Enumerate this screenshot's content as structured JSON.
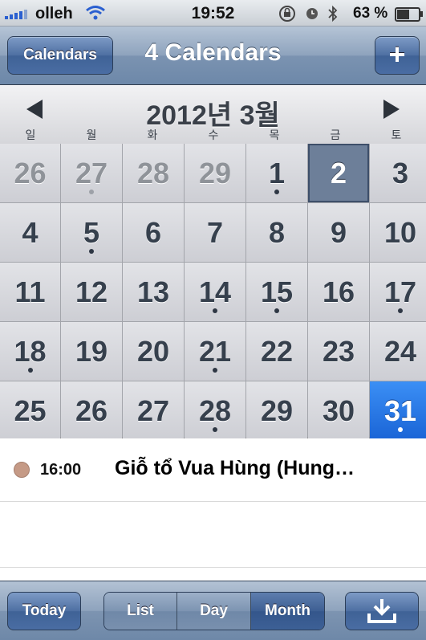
{
  "status_bar": {
    "carrier": "olleh",
    "time": "19:52",
    "battery_percent": "63 %",
    "battery_level": 0.63,
    "icons": [
      "signal-icon",
      "wifi-icon",
      "rotation-lock-icon",
      "alarm-icon",
      "bluetooth-icon",
      "battery-icon"
    ]
  },
  "nav": {
    "calendars_button": "Calendars",
    "title": "4 Calendars",
    "add_button": "+"
  },
  "month": {
    "title": "2012년 3월",
    "weekdays": [
      "일",
      "월",
      "화",
      "수",
      "목",
      "금",
      "토"
    ]
  },
  "days": [
    {
      "label": "26",
      "other_month": true,
      "event": false
    },
    {
      "label": "27",
      "other_month": true,
      "event": true
    },
    {
      "label": "28",
      "other_month": true,
      "event": false
    },
    {
      "label": "29",
      "other_month": true,
      "event": false
    },
    {
      "label": "1",
      "event": true
    },
    {
      "label": "2",
      "event": false,
      "selected": true
    },
    {
      "label": "3",
      "event": false
    },
    {
      "label": "4",
      "event": false
    },
    {
      "label": "5",
      "event": true
    },
    {
      "label": "6",
      "event": false
    },
    {
      "label": "7",
      "event": false
    },
    {
      "label": "8",
      "event": false
    },
    {
      "label": "9",
      "event": false
    },
    {
      "label": "10",
      "event": false
    },
    {
      "label": "11",
      "event": false
    },
    {
      "label": "12",
      "event": false
    },
    {
      "label": "13",
      "event": false
    },
    {
      "label": "14",
      "event": true
    },
    {
      "label": "15",
      "event": true
    },
    {
      "label": "16",
      "event": false
    },
    {
      "label": "17",
      "event": true
    },
    {
      "label": "18",
      "event": true
    },
    {
      "label": "19",
      "event": false
    },
    {
      "label": "20",
      "event": false
    },
    {
      "label": "21",
      "event": true
    },
    {
      "label": "22",
      "event": false
    },
    {
      "label": "23",
      "event": false
    },
    {
      "label": "24",
      "event": false
    },
    {
      "label": "25",
      "event": false
    },
    {
      "label": "26",
      "event": false
    },
    {
      "label": "27",
      "event": false
    },
    {
      "label": "28",
      "event": true
    },
    {
      "label": "29",
      "event": false
    },
    {
      "label": "30",
      "event": false
    },
    {
      "label": "31",
      "event": true,
      "today": true
    }
  ],
  "events": [
    {
      "time": "16:00",
      "title": "Giỗ tổ Vua Hùng (Hung…",
      "color": "#c59a86"
    }
  ],
  "toolbar": {
    "today": "Today",
    "views": [
      "List",
      "Day",
      "Month"
    ],
    "selected_view": "Month",
    "download_icon": "download-icon"
  },
  "colors": {
    "nav_blue": "#6d88a9",
    "today_blue": "#1a64d6",
    "selected_day": "#6d7f99"
  }
}
